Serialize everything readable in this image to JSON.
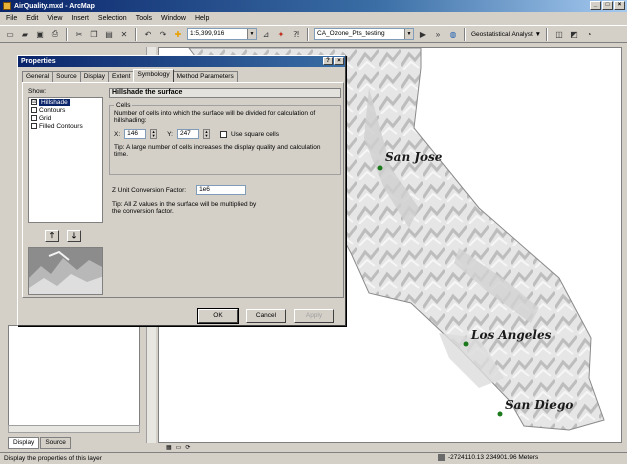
{
  "window": {
    "title": "AirQuality.mxd - ArcMap",
    "controls": [
      "_",
      "□",
      "×"
    ]
  },
  "menu": [
    "File",
    "Edit",
    "View",
    "Insert",
    "Selection",
    "Tools",
    "Window",
    "Help"
  ],
  "toolbar": {
    "scale": "1:5,399,916",
    "layer": "CA_Ozone_Pts_testing",
    "geostat": "Geostatistical Analyst ▼"
  },
  "dialog": {
    "title": "Properties",
    "title_buttons": [
      "?",
      "×"
    ],
    "tabs": [
      "General",
      "Source",
      "Display",
      "Extent",
      "Symbology",
      "Method Parameters"
    ],
    "active_tab": "Symbology",
    "show_label": "Show:",
    "show_items": [
      {
        "label": "Hillshade",
        "checked": "☑",
        "selected": true
      },
      {
        "label": "Contours",
        "checked": "",
        "selected": false
      },
      {
        "label": "Grid",
        "checked": "",
        "selected": false
      },
      {
        "label": "Filled Contours",
        "checked": "",
        "selected": false
      }
    ],
    "up_label": "🡑",
    "down_label": "🡓",
    "heading": "Hillshade the surface",
    "cells_group": "Cells",
    "cells_desc": "Number of cells into which the surface will be divided for calculation of hillshading:",
    "x_label": "X:",
    "x_value": "146",
    "y_label": "Y:",
    "y_value": "247",
    "square_label": "Use square cells",
    "cells_tip": "Tip:  A large number of cells increases the display quality and calculation time.",
    "z_label": "Z Unit Conversion Factor:",
    "z_value": "1e6",
    "z_tip": "Tip:  All Z values in the surface will be multiplied by the conversion factor.",
    "ok": "OK",
    "cancel": "Cancel",
    "apply": "Apply"
  },
  "toc_tabs": [
    "Display",
    "Source"
  ],
  "map": {
    "labels": [
      "San Jose",
      "Los Angeles",
      "San Diego"
    ]
  },
  "status": {
    "message": "Display the properties of this layer",
    "coords": "-2724110.13  234901.96 Meters"
  }
}
